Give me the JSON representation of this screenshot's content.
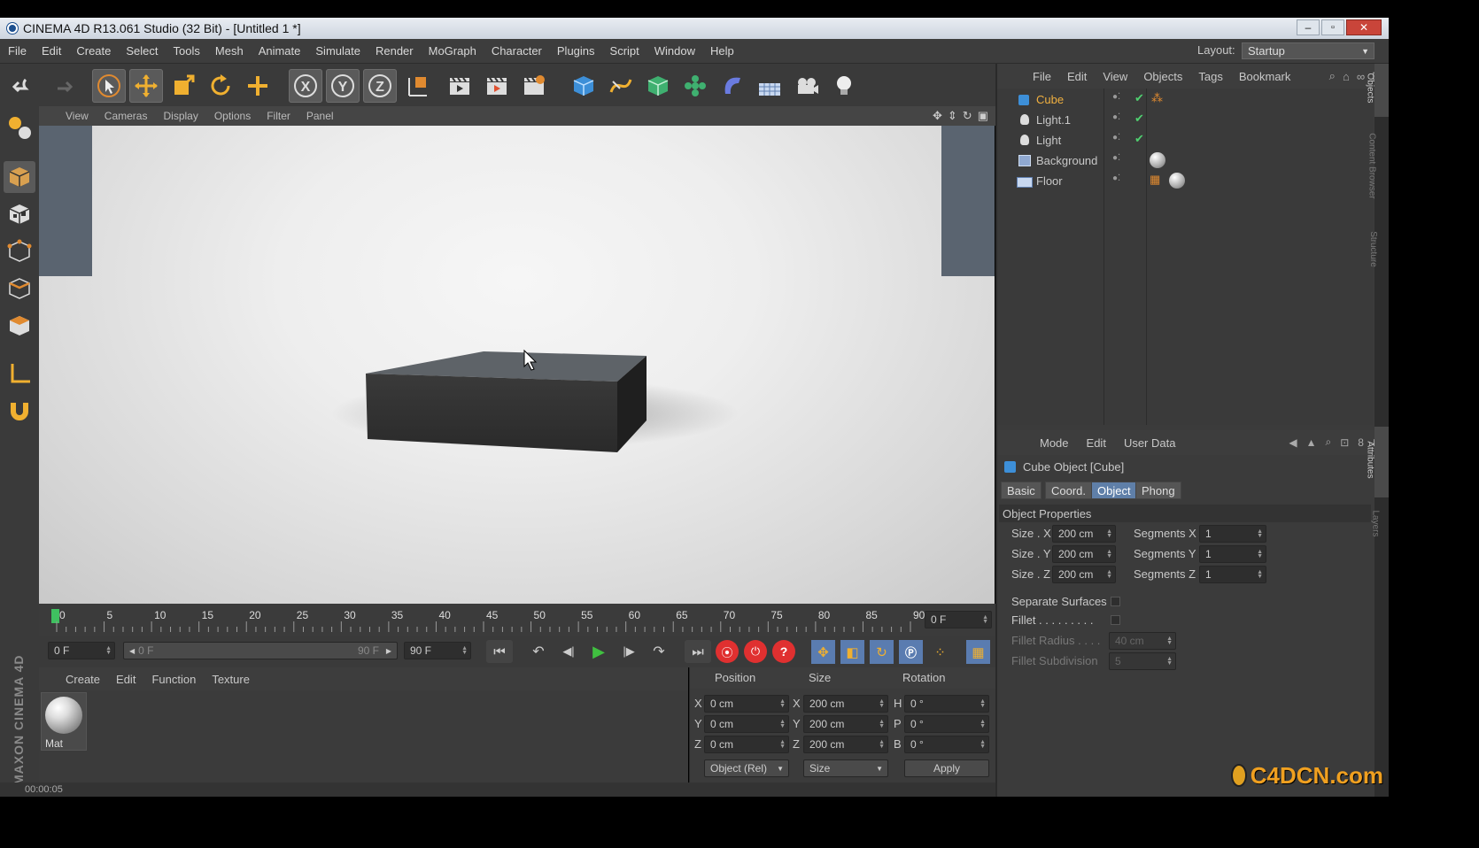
{
  "window": {
    "title": "CINEMA 4D R13.061 Studio (32 Bit) - [Untitled 1 *]"
  },
  "menu": [
    "File",
    "Edit",
    "Create",
    "Select",
    "Tools",
    "Mesh",
    "Animate",
    "Simulate",
    "Render",
    "MoGraph",
    "Character",
    "Plugins",
    "Script",
    "Window",
    "Help"
  ],
  "layout": {
    "label": "Layout:",
    "value": "Startup"
  },
  "viewport": {
    "menu": [
      "View",
      "Cameras",
      "Display",
      "Options",
      "Filter",
      "Panel"
    ]
  },
  "timeline": {
    "ticks": [
      "0",
      "5",
      "10",
      "15",
      "20",
      "25",
      "30",
      "35",
      "40",
      "45",
      "50",
      "55",
      "60",
      "65",
      "70",
      "75",
      "80",
      "85",
      "90"
    ],
    "current": "0 F",
    "start": "0 F",
    "range_start": "0 F",
    "range_end": "90 F",
    "end": "90 F"
  },
  "material": {
    "menu": [
      "Create",
      "Edit",
      "Function",
      "Texture"
    ],
    "mat_name": "Mat"
  },
  "coord": {
    "headers": [
      "Position",
      "Size",
      "Rotation"
    ],
    "rows": [
      {
        "axis": "X",
        "pos": "0 cm",
        "saxis": "X",
        "size": "200 cm",
        "raxis": "H",
        "rot": "0 °"
      },
      {
        "axis": "Y",
        "pos": "0 cm",
        "saxis": "Y",
        "size": "200 cm",
        "raxis": "P",
        "rot": "0 °"
      },
      {
        "axis": "Z",
        "pos": "0 cm",
        "saxis": "Z",
        "size": "200 cm",
        "raxis": "B",
        "rot": "0 °"
      }
    ],
    "mode": "Object (Rel)",
    "size_mode": "Size",
    "apply": "Apply"
  },
  "status": {
    "time": "00:00:05"
  },
  "objects": {
    "menu": [
      "File",
      "Edit",
      "View",
      "Objects",
      "Tags",
      "Bookmark"
    ],
    "items": [
      "Cube",
      "Light.1",
      "Light",
      "Background",
      "Floor"
    ]
  },
  "attributes": {
    "menu": [
      "Mode",
      "Edit",
      "User Data"
    ],
    "title": "Cube Object [Cube]",
    "tabs": [
      "Basic",
      "Coord.",
      "Object",
      "Phong"
    ],
    "section": "Object Properties",
    "props": [
      {
        "label": "Size . X",
        "value": "200 cm",
        "seg_label": "Segments X",
        "seg": "1"
      },
      {
        "label": "Size . Y",
        "value": "200 cm",
        "seg_label": "Segments Y",
        "seg": "1"
      },
      {
        "label": "Size . Z",
        "value": "200 cm",
        "seg_label": "Segments Z",
        "seg": "1"
      }
    ],
    "separate": "Separate Surfaces",
    "fillet": "Fillet . . . . . . . . .",
    "fillet_radius": "Fillet Radius . . . .",
    "fillet_radius_val": "40 cm",
    "fillet_sub": "Fillet Subdivision",
    "fillet_sub_val": "5"
  },
  "side_tabs": [
    "Objects",
    "Content Browser",
    "Structure",
    "Attributes",
    "Layers"
  ],
  "logo": "C4DCN.com",
  "brand": "MAXON CINEMA 4D",
  "colors": {
    "accent": "#5f7fa8",
    "selected_obj": "#f0b040",
    "play": "#40c040",
    "record": "#e03030"
  }
}
